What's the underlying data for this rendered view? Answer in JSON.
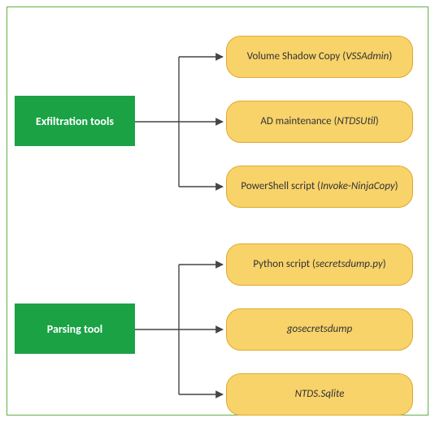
{
  "frame": {
    "border_color": "#62b146"
  },
  "groups": [
    {
      "label": "Exfiltration tools",
      "color": "#1aa245",
      "items": [
        {
          "prefix": "Volume Shadow Copy (",
          "em": "VSSAdmin",
          "suffix": ")"
        },
        {
          "prefix": "AD maintenance (",
          "em": "NTDSUtil",
          "suffix": ")"
        },
        {
          "prefix": "PowerShell script (",
          "em": "Invoke-NinjaCopy",
          "suffix": ")"
        }
      ]
    },
    {
      "label": "Parsing tool",
      "color": "#1aa245",
      "items": [
        {
          "prefix": "Python script (",
          "em": "secretsdump.py",
          "suffix": ")"
        },
        {
          "prefix": "",
          "em": "gosecretsdump",
          "suffix": ""
        },
        {
          "prefix": "",
          "em": "NTDS.Sqlite",
          "suffix": ""
        }
      ]
    }
  ]
}
